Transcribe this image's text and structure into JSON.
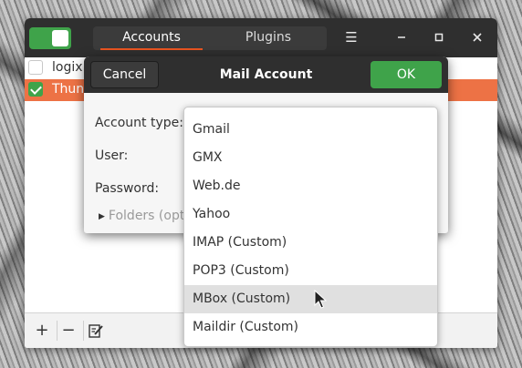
{
  "main_window": {
    "toggle_enabled": true,
    "tabs": [
      {
        "label": "Accounts",
        "active": true
      },
      {
        "label": "Plugins",
        "active": false
      }
    ],
    "menu_icon": "hamburger-icon",
    "window_controls": {
      "minimize": "minimize-icon",
      "maximize": "maximize-icon",
      "close": "close-icon"
    },
    "accounts": [
      {
        "label": "logix.",
        "checked": false,
        "selected": false
      },
      {
        "label": "Thund",
        "checked": true,
        "selected": true
      }
    ],
    "toolbar": {
      "add": "+",
      "remove": "−",
      "edit_icon": "edit-icon"
    }
  },
  "dialog": {
    "cancel_label": "Cancel",
    "title": "Mail Account",
    "ok_label": "OK",
    "fields": {
      "account_type_label": "Account type:",
      "user_label": "User:",
      "password_label": "Password:",
      "folders_label": "Folders (opt"
    }
  },
  "dropdown": {
    "options": [
      "Gmail",
      "GMX",
      "Web.de",
      "Yahoo",
      "IMAP (Custom)",
      "POP3 (Custom)",
      "MBox (Custom)",
      "Maildir (Custom)"
    ],
    "hovered": "MBox (Custom)"
  },
  "colors": {
    "accent_green": "#3fa34a",
    "selection_orange": "#ed7245",
    "tab_underline": "#e95420",
    "headerbar": "#2f2f2f"
  }
}
